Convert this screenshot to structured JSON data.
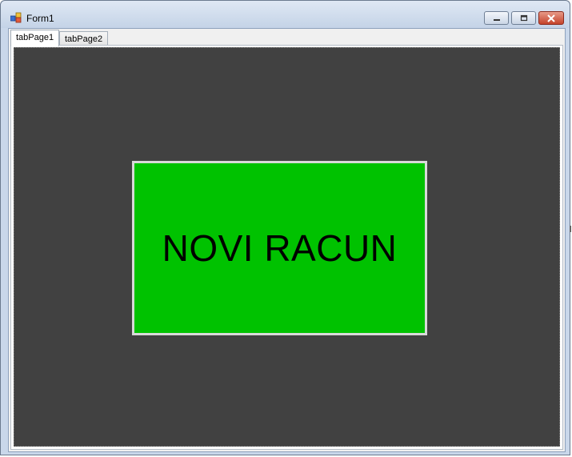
{
  "window": {
    "title": "Form1",
    "icon": "windows-forms-app-icon"
  },
  "titlebar_buttons": {
    "minimize_icon": "minimize-icon",
    "maximize_icon": "maximize-icon",
    "close_icon": "close-icon"
  },
  "tabs": [
    {
      "label": "tabPage1",
      "selected": true
    },
    {
      "label": "tabPage2",
      "selected": false
    }
  ],
  "panel": {
    "background_color": "#414141"
  },
  "main_button": {
    "label": "NOVI RACUN",
    "background_color": "#00c200"
  }
}
